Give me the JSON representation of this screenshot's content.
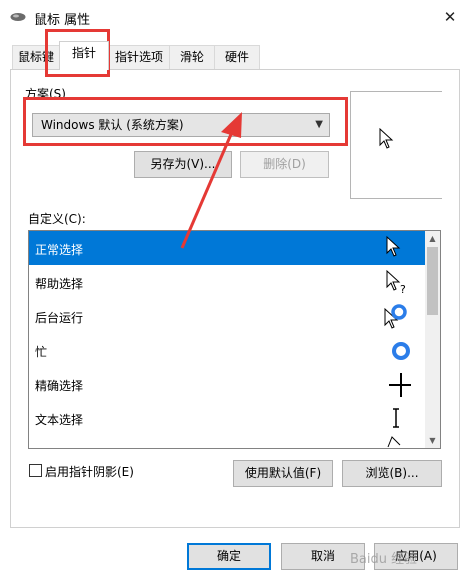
{
  "window": {
    "title": "鼠标 属性",
    "close_glyph": "✕"
  },
  "tabs": [
    {
      "label": "鼠标键",
      "active": false
    },
    {
      "label": "指针",
      "active": true
    },
    {
      "label": "指针选项",
      "active": false
    },
    {
      "label": "滑轮",
      "active": false
    },
    {
      "label": "硬件",
      "active": false
    }
  ],
  "scheme": {
    "label": "方案(S)",
    "selected": "Windows 默认 (系统方案)",
    "save_as_label": "另存为(V)...",
    "delete_label": "删除(D)"
  },
  "customize": {
    "label": "自定义(C):",
    "items": [
      {
        "label": "正常选择",
        "icon": "arrow-cursor-icon",
        "selected": true
      },
      {
        "label": "帮助选择",
        "icon": "help-cursor-icon",
        "selected": false
      },
      {
        "label": "后台运行",
        "icon": "working-in-background-cursor-icon",
        "selected": false
      },
      {
        "label": "忙",
        "icon": "busy-cursor-icon",
        "selected": false
      },
      {
        "label": "精确选择",
        "icon": "crosshair-cursor-icon",
        "selected": false
      },
      {
        "label": "文本选择",
        "icon": "text-beam-cursor-icon",
        "selected": false
      }
    ]
  },
  "shadow_checkbox_label": "启用指针阴影(E)",
  "use_default_label": "使用默认值(F)",
  "browse_label": "浏览(B)...",
  "footer": {
    "ok_label": "确定",
    "cancel_label": "取消",
    "apply_label": "应用(A)"
  },
  "watermark": "Baidu 经验",
  "colors": {
    "selection": "#0078d7",
    "annotation": "#e53935",
    "cursor_blue": "#2b7de9"
  }
}
